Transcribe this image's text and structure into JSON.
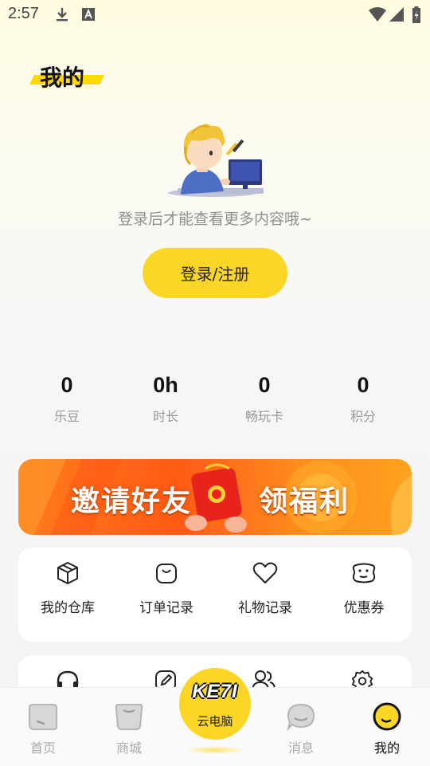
{
  "status_bar": {
    "time": "2:57"
  },
  "header": {
    "title": "我的"
  },
  "login": {
    "hint": "登录后才能查看更多内容哦~",
    "button_label": "登录/注册"
  },
  "stats": [
    {
      "value": "0",
      "label": "乐豆"
    },
    {
      "value": "0h",
      "label": "时长"
    },
    {
      "value": "0",
      "label": "畅玩卡"
    },
    {
      "value": "0",
      "label": "积分"
    }
  ],
  "banner": {
    "left_text": "邀请好友",
    "right_text": "领福利"
  },
  "menu": [
    {
      "label": "我的仓库",
      "icon": "box-icon"
    },
    {
      "label": "订单记录",
      "icon": "shopping-bag-icon"
    },
    {
      "label": "礼物记录",
      "icon": "heart-icon"
    },
    {
      "label": "优惠券",
      "icon": "coupon-icon"
    }
  ],
  "menu2_icons": [
    "headset-icon",
    "edit-icon",
    "users-icon",
    "settings-icon"
  ],
  "tabbar": {
    "home": "首页",
    "mall": "商城",
    "center_logo": "KE7I",
    "center": "云电脑",
    "messages": "消息",
    "mine": "我的"
  },
  "colors": {
    "accent": "#fcd627",
    "banner": "#ff6a1a"
  }
}
